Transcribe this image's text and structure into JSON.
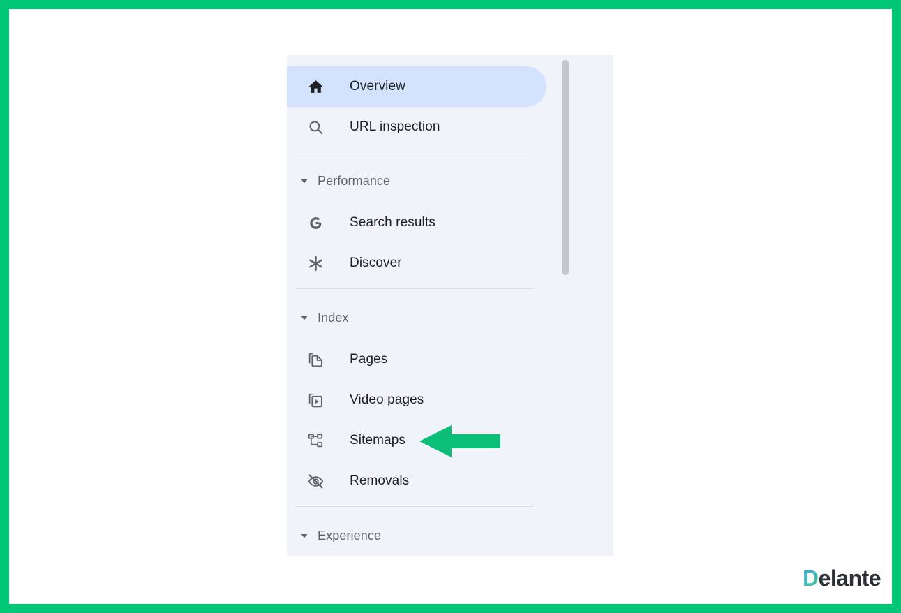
{
  "frame": {
    "border_color": "#00c776",
    "background_color": "#ffffff"
  },
  "sidebar": {
    "background_color": "#f1f3fb",
    "selected_color": "#d3e3fd",
    "scrollbar": {
      "name": "vertical-scrollbar",
      "thumb_color": "#c4c6ca"
    },
    "top_items": [
      {
        "label": "Overview",
        "icon": "home-icon",
        "selected": true
      },
      {
        "label": "URL inspection",
        "icon": "search-icon",
        "selected": false
      }
    ],
    "sections": [
      {
        "label": "Performance",
        "expanded": true,
        "items": [
          {
            "label": "Search results",
            "icon": "google-g-icon"
          },
          {
            "label": "Discover",
            "icon": "discover-asterisk-icon"
          }
        ]
      },
      {
        "label": "Index",
        "expanded": true,
        "items": [
          {
            "label": "Pages",
            "icon": "pages-documents-icon"
          },
          {
            "label": "Video pages",
            "icon": "video-pages-icon"
          },
          {
            "label": "Sitemaps",
            "icon": "sitemap-tree-icon"
          },
          {
            "label": "Removals",
            "icon": "eye-off-icon"
          }
        ]
      },
      {
        "label": "Experience",
        "expanded": true,
        "items": []
      }
    ]
  },
  "annotation": {
    "arrow": {
      "name": "green-pointer-arrow",
      "direction": "left",
      "color": "#0bbf78",
      "points_to": "Sitemaps"
    }
  },
  "branding": {
    "logo_first_letter": "D",
    "logo_rest": "elante",
    "gradient_from": "#3ba7e0",
    "gradient_to": "#46c78e",
    "text_color": "#2b2f38"
  }
}
